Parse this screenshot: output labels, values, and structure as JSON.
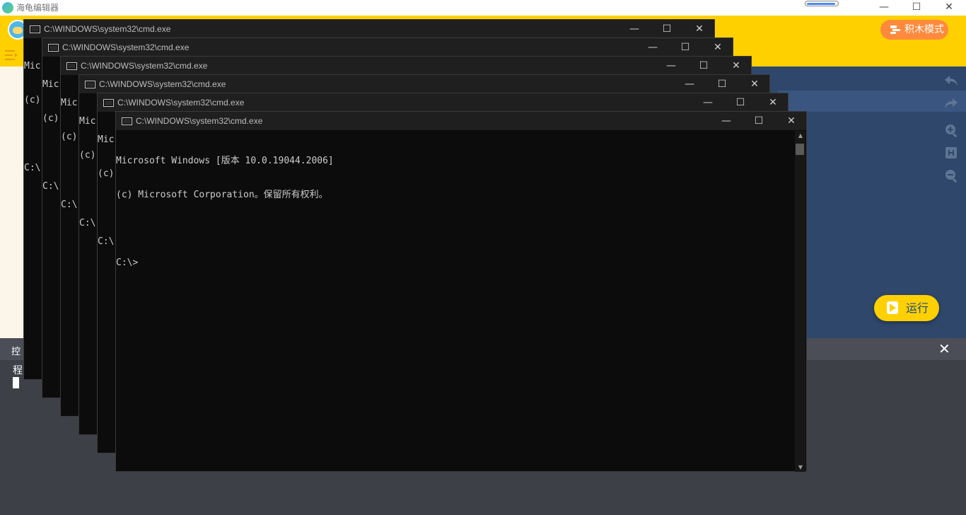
{
  "app": {
    "title": "海龟编辑器",
    "mode_button": "积木模式",
    "run_button": "运行",
    "icons": [
      "menu-icon",
      "undo-icon",
      "redo-icon",
      "zoom-in-icon",
      "fit-icon",
      "zoom-out-icon",
      "play-icon"
    ],
    "colors": {
      "header": "#ffd000",
      "code_bg": "#2e476b",
      "mode_button": "#ff8a3d",
      "console_bg": "#3d4047"
    }
  },
  "console": {
    "title": "控",
    "first_line": "程"
  },
  "cmd_windows": [
    {
      "title": "C:\\WINDOWS\\system32\\cmd.exe",
      "visible_lines": [
        "Mic",
        "(c)",
        "",
        "C:\\"
      ]
    },
    {
      "title": "C:\\WINDOWS\\system32\\cmd.exe",
      "visible_lines": [
        "Mic",
        "(c)",
        "",
        "C:\\"
      ]
    },
    {
      "title": "C:\\WINDOWS\\system32\\cmd.exe",
      "visible_lines": [
        "Mic",
        "(c)",
        "",
        "C:\\"
      ]
    },
    {
      "title": "C:\\WINDOWS\\system32\\cmd.exe",
      "visible_lines": [
        "Mic",
        "(c)",
        "",
        "C:\\"
      ]
    },
    {
      "title": "C:\\WINDOWS\\system32\\cmd.exe",
      "visible_lines": [
        "Mic",
        "(c)",
        "",
        "C:\\"
      ]
    },
    {
      "title": "C:\\WINDOWS\\system32\\cmd.exe",
      "visible_lines": [
        "Microsoft Windows [版本 10.0.19044.2006]",
        "(c) Microsoft Corporation。保留所有权利。",
        "",
        "C:\\>"
      ]
    }
  ],
  "window_controls": {
    "minimize": "—",
    "maximize": "☐",
    "close": "✕"
  }
}
